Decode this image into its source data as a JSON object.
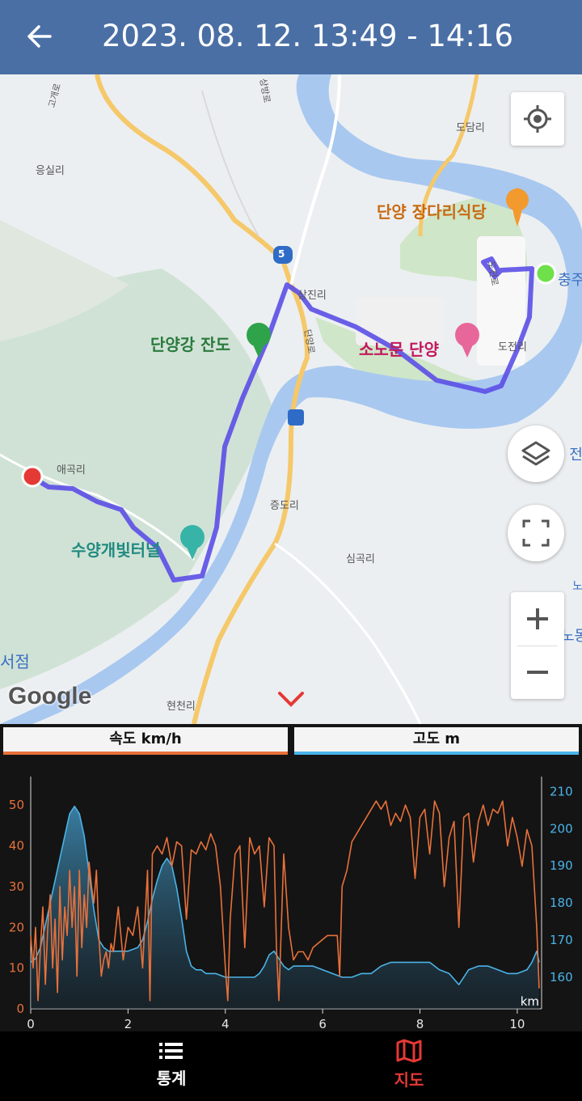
{
  "header": {
    "title": "2023. 08. 12. 13:49 - 14:16"
  },
  "map": {
    "labels": {
      "dodam": "도담리",
      "eungsil": "응실리",
      "sangjin": "상진리",
      "dojeon": "도전리",
      "aegok": "애곡리",
      "jeungdo": "증도리",
      "simgok": "심곡리",
      "hyeoncheon": "현천리",
      "dangyang_restaurant": "단양 장다리식당",
      "dangyanggang": "단양강 잔도",
      "sonomun": "소노문 단양",
      "suyang": "수양개빛터널",
      "seojeom": "서점",
      "route_num": "5",
      "chungju": "충주호",
      "san_jeon": "산 전",
      "no": "노",
      "nodong": "노동",
      "dangyang_ro": "단양로",
      "sangbang_ro": "상방로",
      "ro_left": "고개로",
      "dojeon_ro": "도전로"
    },
    "google_logo": "Google"
  },
  "tabs": {
    "speed_label": "속도 km/h",
    "altitude_label": "고도 m"
  },
  "chart_data": {
    "type": "line",
    "x_label": "km",
    "x_ticks": [
      0,
      2,
      4,
      6,
      8,
      10
    ],
    "xlim": [
      0,
      10.5
    ],
    "y_left": {
      "ticks": [
        0,
        10,
        20,
        30,
        40,
        50
      ],
      "lim": [
        0,
        57
      ]
    },
    "y_right": {
      "ticks": [
        160,
        170,
        180,
        190,
        200,
        210
      ],
      "lim": [
        151.5,
        214
      ]
    },
    "series": [
      {
        "name": "속도 km/h",
        "axis": "left",
        "color": "#e8713a",
        "x": [
          0,
          0.05,
          0.1,
          0.15,
          0.2,
          0.25,
          0.3,
          0.35,
          0.4,
          0.45,
          0.5,
          0.55,
          0.6,
          0.65,
          0.7,
          0.75,
          0.8,
          0.85,
          0.9,
          0.95,
          1.0,
          1.05,
          1.1,
          1.15,
          1.2,
          1.25,
          1.3,
          1.35,
          1.4,
          1.45,
          1.5,
          1.55,
          1.6,
          1.65,
          1.7,
          1.8,
          1.9,
          2.0,
          2.1,
          2.2,
          2.3,
          2.4,
          2.45,
          2.5,
          2.6,
          2.7,
          2.8,
          2.9,
          3.0,
          3.1,
          3.2,
          3.3,
          3.4,
          3.5,
          3.6,
          3.7,
          3.8,
          3.9,
          4.0,
          4.05,
          4.1,
          4.2,
          4.3,
          4.4,
          4.5,
          4.6,
          4.7,
          4.8,
          4.9,
          5.0,
          5.05,
          5.1,
          5.2,
          5.3,
          5.4,
          5.5,
          5.6,
          5.7,
          5.8,
          5.9,
          6.0,
          6.1,
          6.2,
          6.3,
          6.35,
          6.4,
          6.5,
          6.6,
          6.7,
          6.8,
          6.9,
          7.0,
          7.1,
          7.2,
          7.3,
          7.4,
          7.5,
          7.6,
          7.7,
          7.8,
          7.9,
          8.0,
          8.1,
          8.2,
          8.3,
          8.4,
          8.5,
          8.6,
          8.7,
          8.8,
          8.9,
          9.0,
          9.1,
          9.2,
          9.3,
          9.4,
          9.5,
          9.6,
          9.7,
          9.8,
          9.9,
          10.0,
          10.1,
          10.2,
          10.3,
          10.4,
          10.45
        ],
        "values": [
          18,
          10,
          20,
          2,
          15,
          25,
          6,
          20,
          28,
          10,
          22,
          4,
          30,
          12,
          25,
          18,
          34,
          20,
          30,
          8,
          34,
          15,
          28,
          20,
          36,
          30,
          26,
          34,
          18,
          8,
          12,
          14,
          10,
          16,
          14,
          25,
          12,
          20,
          18,
          25,
          10,
          34,
          2,
          38,
          40,
          38,
          42,
          35,
          41,
          40,
          22,
          39,
          38,
          41,
          39,
          43,
          40,
          30,
          10,
          2,
          22,
          38,
          40,
          15,
          42,
          38,
          40,
          25,
          42,
          40,
          15,
          2,
          38,
          20,
          12,
          14,
          14,
          12,
          15,
          16,
          17,
          18,
          18,
          18,
          8,
          30,
          34,
          41,
          43,
          45,
          47,
          49,
          51,
          49,
          51,
          45,
          48,
          46,
          50,
          47,
          32,
          47,
          49,
          38,
          51,
          48,
          30,
          42,
          46,
          20,
          47,
          48,
          36,
          46,
          50,
          45,
          49,
          48,
          51,
          40,
          47,
          42,
          35,
          44,
          40,
          20,
          5
        ]
      },
      {
        "name": "고도 m",
        "axis": "right",
        "color": "#4ab3e8",
        "x": [
          0,
          0.1,
          0.2,
          0.3,
          0.4,
          0.5,
          0.6,
          0.7,
          0.8,
          0.9,
          1.0,
          1.1,
          1.2,
          1.3,
          1.4,
          1.5,
          1.6,
          1.8,
          2.0,
          2.2,
          2.3,
          2.4,
          2.5,
          2.6,
          2.7,
          2.8,
          2.9,
          3.0,
          3.1,
          3.2,
          3.3,
          3.4,
          3.5,
          3.6,
          3.7,
          3.8,
          4.0,
          4.2,
          4.4,
          4.6,
          4.7,
          4.8,
          4.9,
          5.0,
          5.1,
          5.2,
          5.3,
          5.4,
          5.6,
          5.8,
          6.0,
          6.2,
          6.4,
          6.6,
          6.8,
          7.0,
          7.2,
          7.4,
          7.6,
          7.8,
          8.0,
          8.2,
          8.4,
          8.6,
          8.8,
          9.0,
          9.2,
          9.4,
          9.6,
          9.8,
          10.0,
          10.2,
          10.3,
          10.4,
          10.45
        ],
        "values": [
          164,
          165,
          168,
          174,
          180,
          186,
          192,
          198,
          204,
          206,
          204,
          198,
          188,
          178,
          170,
          168,
          167,
          167,
          167,
          168,
          170,
          175,
          181,
          186,
          190,
          192,
          190,
          184,
          176,
          167,
          163,
          162,
          162,
          161,
          161,
          161,
          160,
          160,
          160,
          160,
          161,
          163,
          166,
          167,
          165,
          163,
          162,
          163,
          163,
          163,
          162,
          161,
          160,
          160,
          161,
          161,
          163,
          164,
          164,
          164,
          164,
          164,
          162,
          161,
          158,
          162,
          163,
          163,
          162,
          161,
          161,
          162,
          164,
          167,
          164
        ]
      }
    ]
  },
  "bottom_nav": {
    "stats_label": "통계",
    "map_label": "지도",
    "active_color": "#e53935"
  }
}
